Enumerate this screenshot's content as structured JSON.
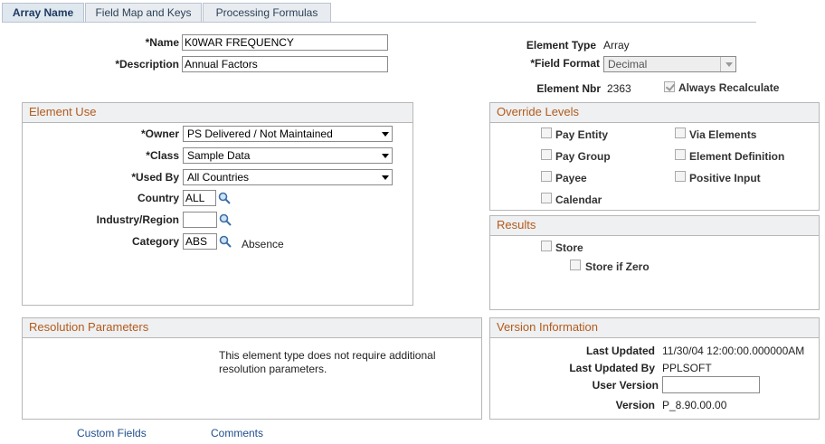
{
  "tabs": [
    {
      "label": "Array Name",
      "active": true
    },
    {
      "label": "Field Map and Keys",
      "active": false
    },
    {
      "label": "Processing Formulas",
      "active": false
    }
  ],
  "header": {
    "name_label": "*Name",
    "name_value": "K0WAR FREQUENCY",
    "description_label": "*Description",
    "description_value": "Annual Factors",
    "element_type_label": "Element Type",
    "element_type_value": "Array",
    "field_format_label": "*Field Format",
    "field_format_value": "Decimal",
    "element_nbr_label": "Element Nbr",
    "element_nbr_value": "2363",
    "always_recalculate_label": "Always Recalculate",
    "always_recalculate_checked": true
  },
  "element_use": {
    "title": "Element Use",
    "owner_label": "*Owner",
    "owner_value": "PS Delivered / Not Maintained",
    "class_label": "*Class",
    "class_value": "Sample Data",
    "used_by_label": "*Used By",
    "used_by_value": "All Countries",
    "country_label": "Country",
    "country_value": "ALL",
    "industry_label": "Industry/Region",
    "industry_value": "",
    "category_label": "Category",
    "category_value": "ABS",
    "category_desc": "Absence"
  },
  "override_levels": {
    "title": "Override Levels",
    "items": [
      {
        "label": "Pay Entity",
        "checked": false
      },
      {
        "label": "Via Elements",
        "checked": false
      },
      {
        "label": "Pay Group",
        "checked": false
      },
      {
        "label": "Element Definition",
        "checked": false
      },
      {
        "label": "Payee",
        "checked": false
      },
      {
        "label": "Positive Input",
        "checked": false
      },
      {
        "label": "Calendar",
        "checked": false
      }
    ]
  },
  "results": {
    "title": "Results",
    "store_label": "Store",
    "store_if_zero_label": "Store if Zero"
  },
  "resolution": {
    "title": "Resolution Parameters",
    "message_line1": "This element type does not require additional",
    "message_line2": "resolution parameters."
  },
  "version": {
    "title": "Version Information",
    "last_updated_label": "Last Updated",
    "last_updated_value": "11/30/04 12:00:00.000000AM",
    "last_updated_by_label": "Last Updated By",
    "last_updated_by_value": "PPLSOFT",
    "user_version_label": "User Version",
    "user_version_value": "",
    "version_label": "Version",
    "version_value": "P_8.90.00.00"
  },
  "footer": {
    "custom_fields": "Custom Fields",
    "comments": "Comments"
  },
  "icons": {
    "lookup": "magnifier-icon",
    "dropdown": "chevron-down-icon",
    "checkbox": "checkbox-icon"
  },
  "colors": {
    "group_title": "#b35a1a",
    "link": "#1f4e8c",
    "group_header_bg": "#eef0f2"
  }
}
